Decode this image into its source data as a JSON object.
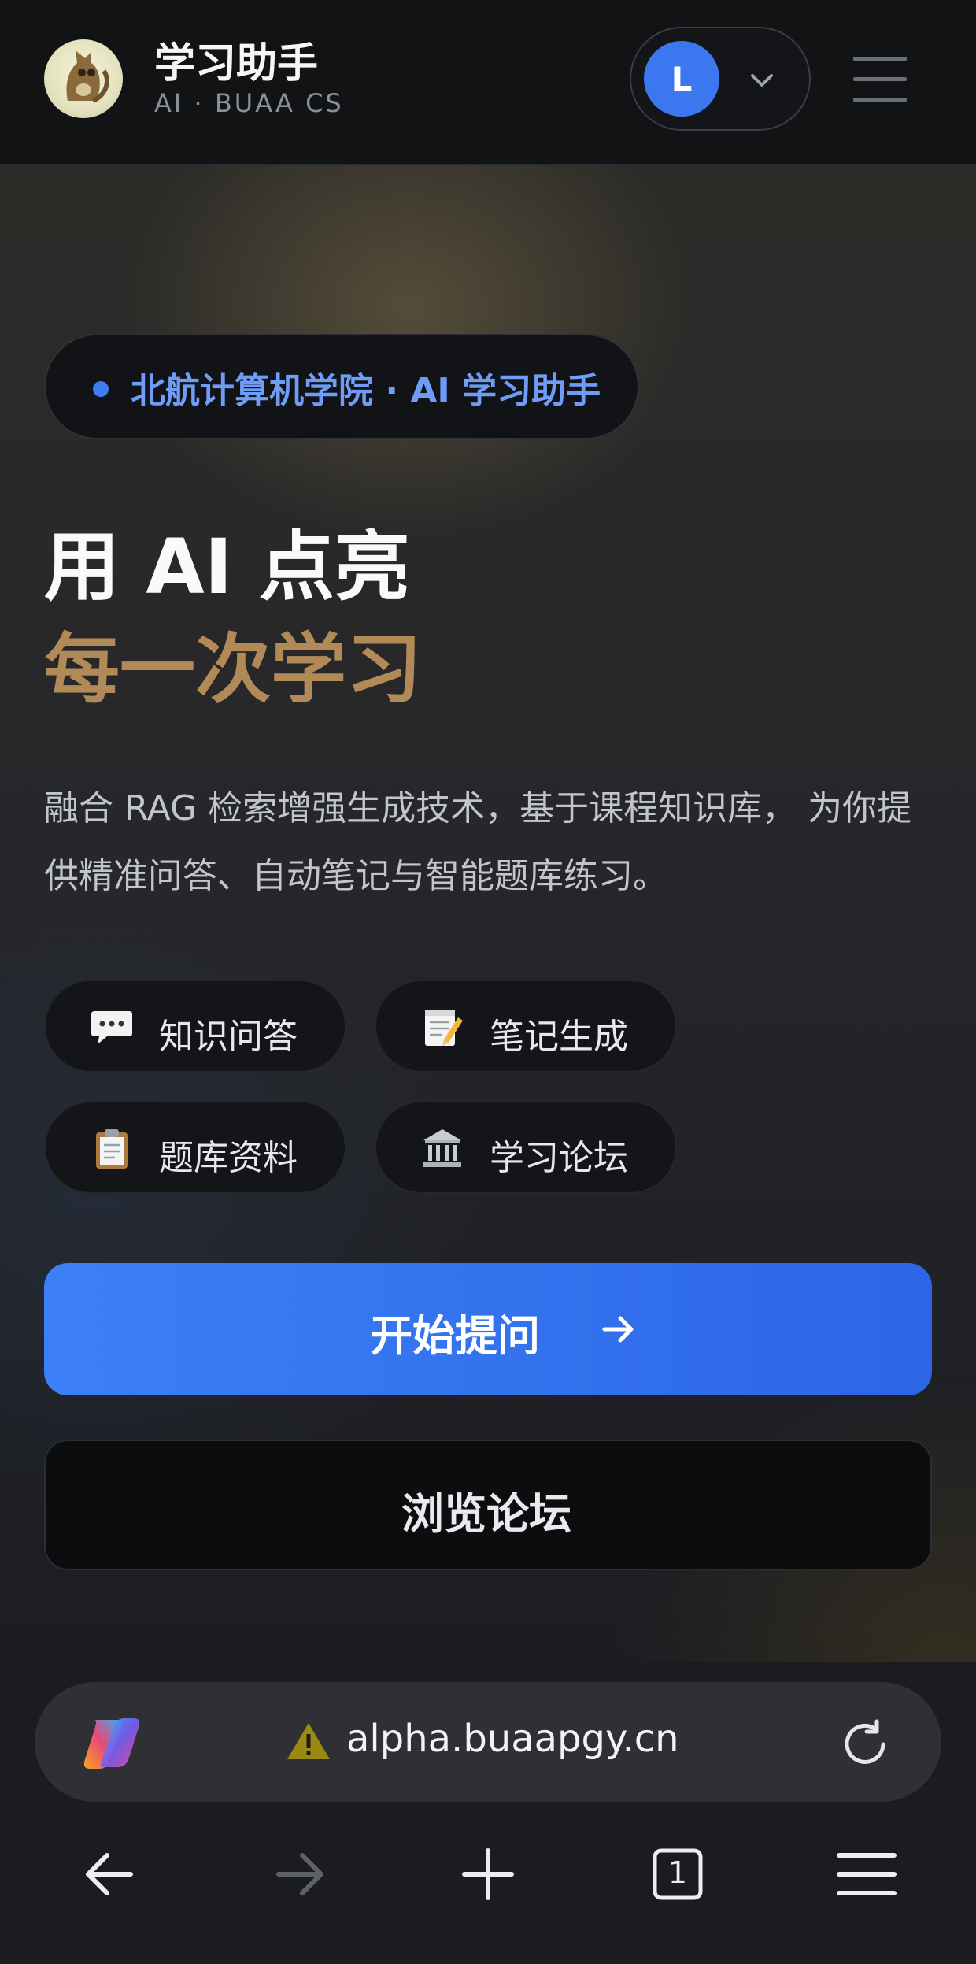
{
  "header": {
    "title": "学习助手",
    "subtitle": "AI · BUAA CS",
    "user_initial": "L"
  },
  "hero": {
    "badge": "北航计算机学院 · AI 学习助手",
    "headline_line1": "用 AI 点亮",
    "headline_line2": "每一次学习",
    "description": "融合 RAG 检索增强生成技术，基于课程知识库， 为你提供精准问答、自动笔记与智能题库练习。",
    "features": [
      {
        "label": "知识问答",
        "icon": "speech-bubble-icon"
      },
      {
        "label": "笔记生成",
        "icon": "memo-icon"
      },
      {
        "label": "题库资料",
        "icon": "clipboard-icon"
      },
      {
        "label": "学习论坛",
        "icon": "classical-building-icon"
      }
    ],
    "primary_button": "开始提问",
    "secondary_button": "浏览论坛"
  },
  "browser": {
    "url": "alpha.buaapgy.cn",
    "tab_count": "1"
  },
  "colors": {
    "accent": "#3b78f0",
    "headline_gold": "#b28a57",
    "badge_text": "#6f9cf6"
  }
}
